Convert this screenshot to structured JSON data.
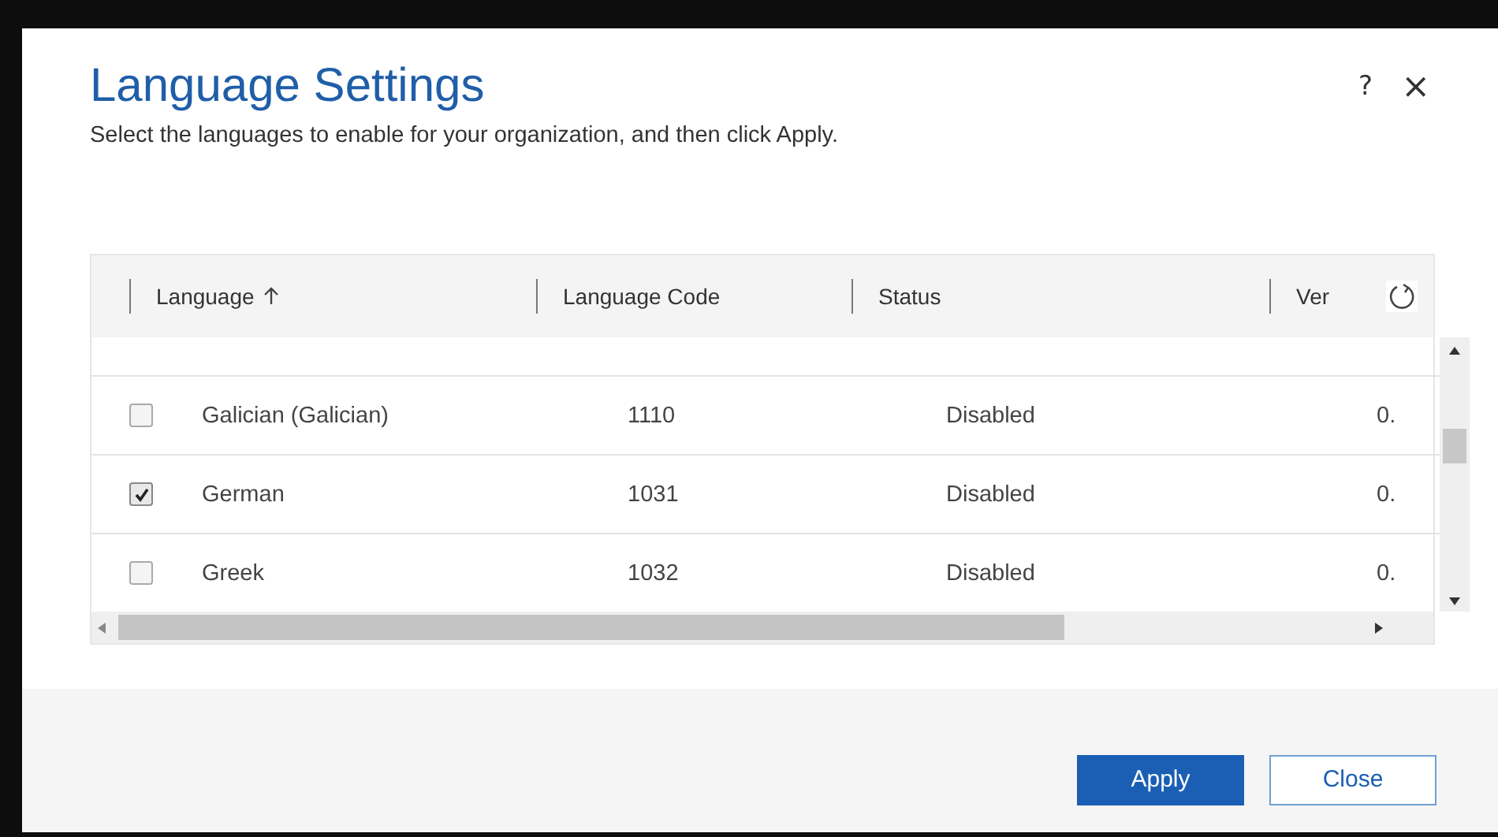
{
  "dialog": {
    "title": "Language Settings",
    "subtitle": "Select the languages to enable for your organization, and then click Apply.",
    "help": "?",
    "close_icon": "×"
  },
  "table": {
    "columns": [
      {
        "label": "Language",
        "sorted": true
      },
      {
        "label": "Language Code",
        "sorted": false
      },
      {
        "label": "Status",
        "sorted": false
      },
      {
        "label": "Ver",
        "sorted": false
      }
    ],
    "rows": [
      {
        "checked": false,
        "cells": [
          "Galician (Galician)",
          "1110",
          "Disabled",
          "0."
        ]
      },
      {
        "checked": true,
        "cells": [
          "German",
          "1031",
          "Disabled",
          "0."
        ]
      },
      {
        "checked": false,
        "cells": [
          "Greek",
          "1032",
          "Disabled",
          "0."
        ]
      }
    ]
  },
  "buttons": [
    {
      "label": "Apply",
      "kind": "primary"
    },
    {
      "label": "Close",
      "kind": "secondary"
    }
  ]
}
